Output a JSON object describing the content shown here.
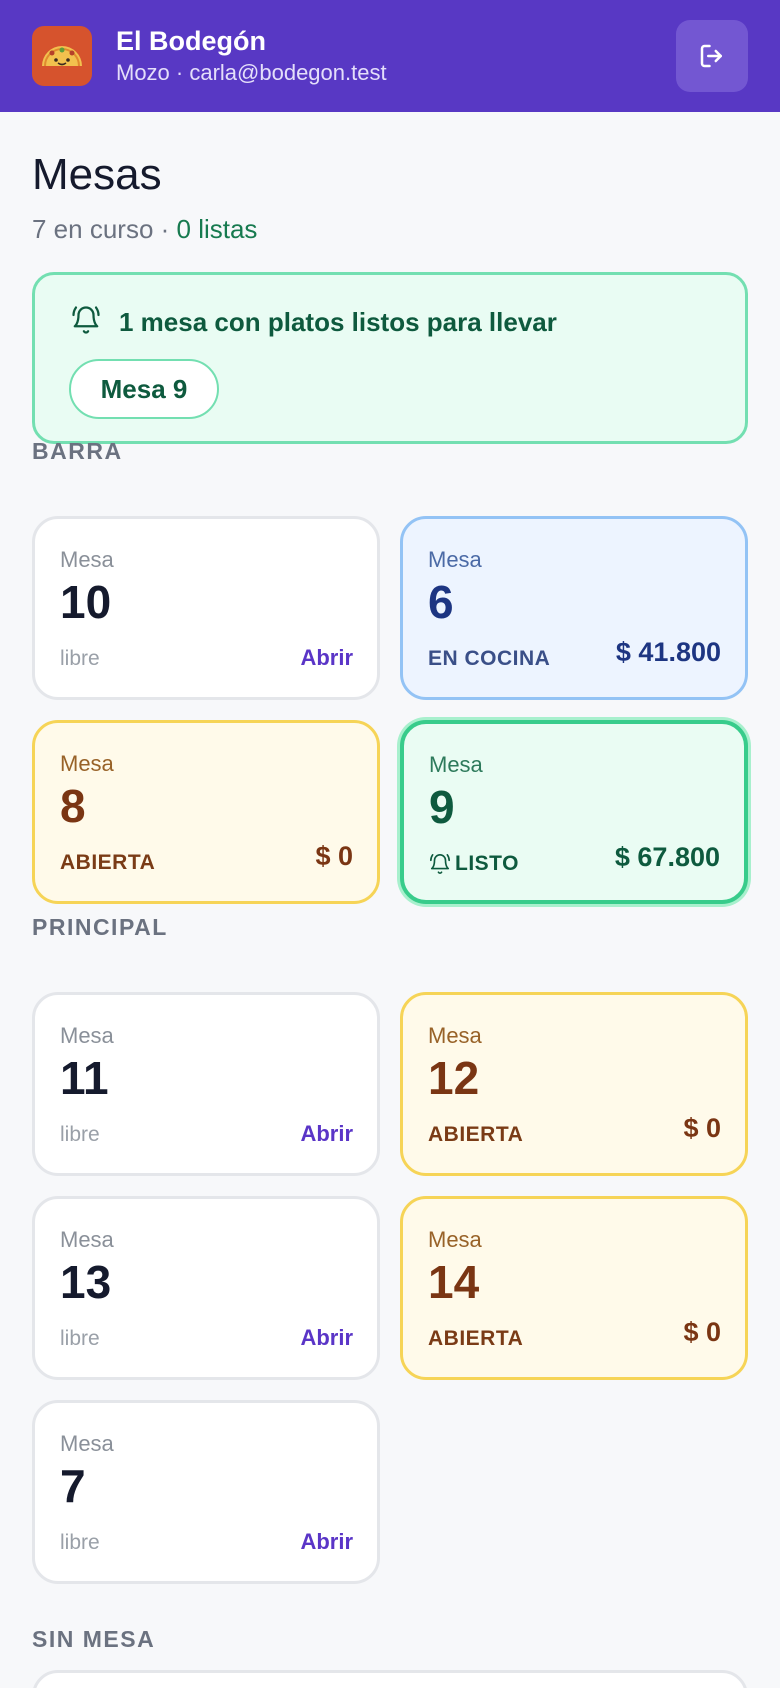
{
  "header": {
    "title": "El Bodegón",
    "subtitle": "Mozo · carla@bodegon.test",
    "logo_icon": "taco-logo-icon",
    "logout_icon": "logout-icon",
    "brand_color": "#5838c4"
  },
  "page": {
    "title": "Mesas",
    "summary_count": "7 en curso · ",
    "summary_ready": "0 listas"
  },
  "alert": {
    "icon": "bell-icon",
    "text": "1 mesa con platos listos para llevar",
    "chips": [
      "Mesa 9"
    ]
  },
  "sections": [
    {
      "label": "BARRA",
      "tables": [
        {
          "label": "Mesa",
          "number": "10",
          "status": "libre",
          "action": "Abrir",
          "state": "free"
        },
        {
          "label": "Mesa",
          "number": "6",
          "status": "EN COCINA",
          "amount": "$ 41.800",
          "state": "cooking"
        },
        {
          "label": "Mesa",
          "number": "8",
          "status": "ABIERTA",
          "amount": "$ 0",
          "state": "open"
        },
        {
          "label": "Mesa",
          "number": "9",
          "status": "LISTO",
          "amount": "$ 67.800",
          "state": "ready"
        }
      ]
    },
    {
      "label": "PRINCIPAL",
      "tables": [
        {
          "label": "Mesa",
          "number": "11",
          "status": "libre",
          "action": "Abrir",
          "state": "free"
        },
        {
          "label": "Mesa",
          "number": "12",
          "status": "ABIERTA",
          "amount": "$ 0",
          "state": "open"
        },
        {
          "label": "Mesa",
          "number": "13",
          "status": "libre",
          "action": "Abrir",
          "state": "free"
        },
        {
          "label": "Mesa",
          "number": "14",
          "status": "ABIERTA",
          "amount": "$ 0",
          "state": "open"
        },
        {
          "label": "Mesa",
          "number": "7",
          "status": "libre",
          "action": "Abrir",
          "state": "free"
        }
      ]
    },
    {
      "label": "SIN MESA",
      "tables": []
    }
  ]
}
